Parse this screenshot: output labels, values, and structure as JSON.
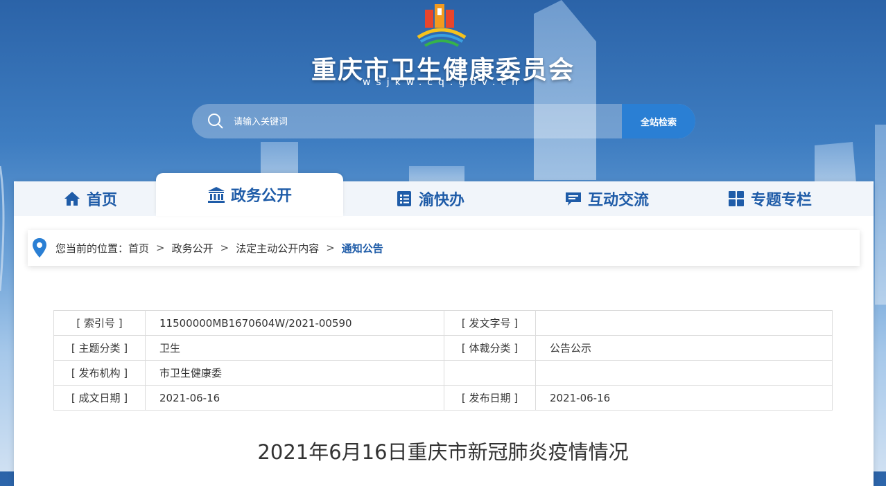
{
  "header": {
    "site_title": "重庆市卫生健康委员会",
    "site_domain": "wsjkw.cq.gov.cn"
  },
  "search": {
    "placeholder": "请输入关键词",
    "button_label": "全站检索"
  },
  "nav": {
    "items": [
      {
        "label": "首页",
        "icon": "home-icon"
      },
      {
        "label": "政务公开",
        "icon": "government-building-icon",
        "active": true
      },
      {
        "label": "渝快办",
        "icon": "checklist-icon"
      },
      {
        "label": "互动交流",
        "icon": "chat-bubble-icon"
      },
      {
        "label": "专题专栏",
        "icon": "grid-icon"
      }
    ]
  },
  "breadcrumb": {
    "prefix": "您当前的位置：",
    "items": [
      "首页",
      "政务公开",
      "法定主动公开内容",
      "通知公告"
    ],
    "separator": ">"
  },
  "meta": {
    "rows": [
      {
        "label1": "[ 索引号 ]",
        "value1": "11500000MB1670604W/2021-00590",
        "label2": "[ 发文字号 ]",
        "value2": ""
      },
      {
        "label1": "[ 主题分类 ]",
        "value1": "卫生",
        "label2": "[ 体裁分类 ]",
        "value2": "公告公示"
      },
      {
        "label1": "[ 发布机构 ]",
        "value1": "市卫生健康委",
        "label2": "",
        "value2": ""
      },
      {
        "label1": "[ 成文日期 ]",
        "value1": "2021-06-16",
        "label2": "[ 发布日期 ]",
        "value2": "2021-06-16"
      }
    ]
  },
  "document": {
    "title": "2021年6月16日重庆市新冠肺炎疫情情况"
  },
  "colors": {
    "brand_blue": "#1f5ca8",
    "button_blue": "#2a7fd4"
  }
}
